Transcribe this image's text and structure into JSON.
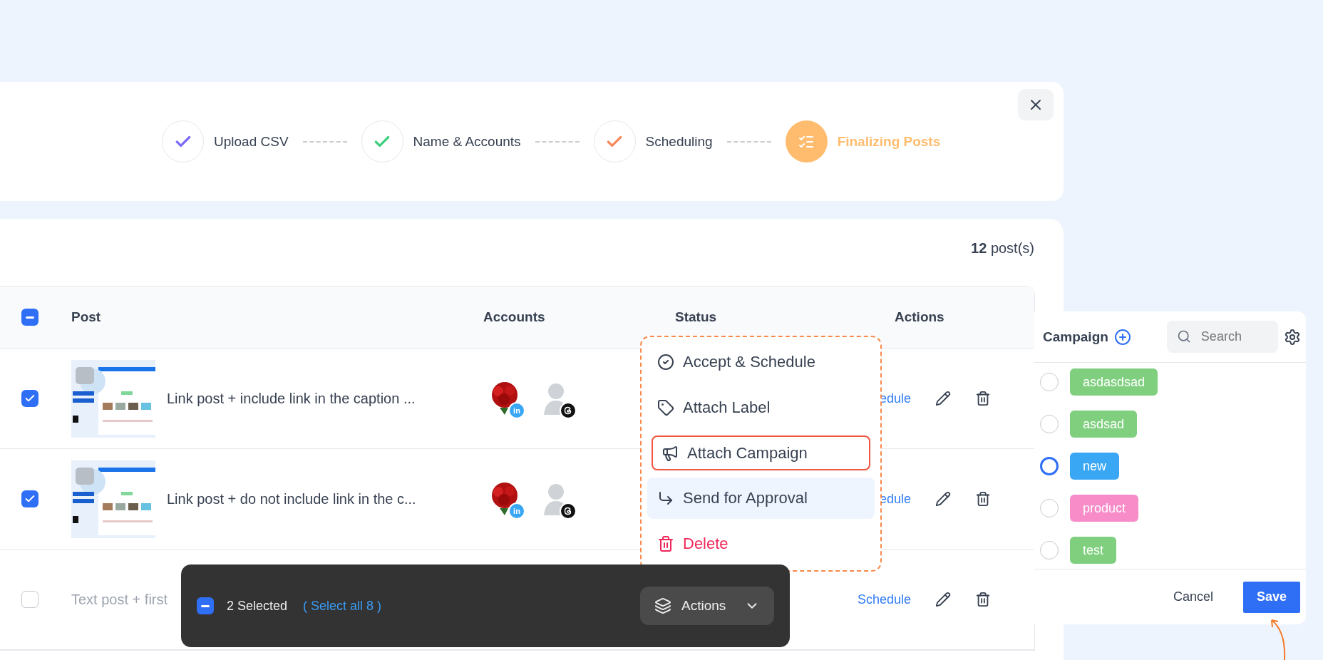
{
  "stepper": {
    "steps": [
      {
        "label": "Upload CSV",
        "active": false,
        "color": "#7b6cf6"
      },
      {
        "label": "Name & Accounts",
        "active": false,
        "color": "#3ecf7f"
      },
      {
        "label": "Scheduling",
        "active": false,
        "color": "#f58a5f"
      },
      {
        "label": "Finalizing Posts",
        "active": true,
        "color": "#ffbc6e"
      }
    ]
  },
  "post_count": {
    "number": "12",
    "label": "post(s)"
  },
  "table": {
    "header_checkbox": {
      "indeterminate": true
    },
    "columns": [
      "Post",
      "Accounts",
      "Status",
      "Actions"
    ],
    "rows": [
      {
        "checked": true,
        "text": "Link post + include link in the caption ...",
        "accounts": [
          {
            "kind": "linkedin",
            "badge": "in"
          },
          {
            "kind": "threads"
          }
        ],
        "schedule": "edule"
      },
      {
        "checked": true,
        "text": "Link post + do not include link in the c...",
        "accounts": [
          {
            "kind": "linkedin",
            "badge": "in"
          },
          {
            "kind": "threads"
          }
        ],
        "schedule": "edule"
      },
      {
        "checked": false,
        "kind": "text",
        "text": "Text post + first",
        "schedule": "Schedule"
      }
    ]
  },
  "action_menu": {
    "items": [
      {
        "label": "Accept & Schedule",
        "kind": "accept",
        "highlighted": false,
        "hovered": false
      },
      {
        "label": "Attach Label",
        "kind": "label",
        "highlighted": false,
        "hovered": false
      },
      {
        "label": "Attach Campaign",
        "kind": "campaign",
        "highlighted": true,
        "hovered": false
      },
      {
        "label": "Send for Approval",
        "kind": "approval",
        "highlighted": false,
        "hovered": true
      },
      {
        "label": "Delete",
        "kind": "delete",
        "highlighted": false,
        "hovered": false
      }
    ]
  },
  "selection_bar": {
    "checkbox": {
      "indeterminate": true
    },
    "count": "2 Selected",
    "select_all": "( Select all 8 )",
    "actions_button": "Actions"
  },
  "campaign_panel": {
    "title": "Campaign",
    "search": {
      "placeholder": "Search"
    },
    "items": [
      {
        "label": "asdasdsad",
        "color": "#7fcf7f",
        "selected": false
      },
      {
        "label": "asdsad",
        "color": "#7fcf7f",
        "selected": false
      },
      {
        "label": "new",
        "color": "#3aa7f5",
        "selected": true
      },
      {
        "label": "product",
        "color": "#f78cc8",
        "selected": false
      },
      {
        "label": "test",
        "color": "#7fcf7f",
        "selected": false
      }
    ],
    "cancel": "Cancel",
    "save": "Save"
  }
}
